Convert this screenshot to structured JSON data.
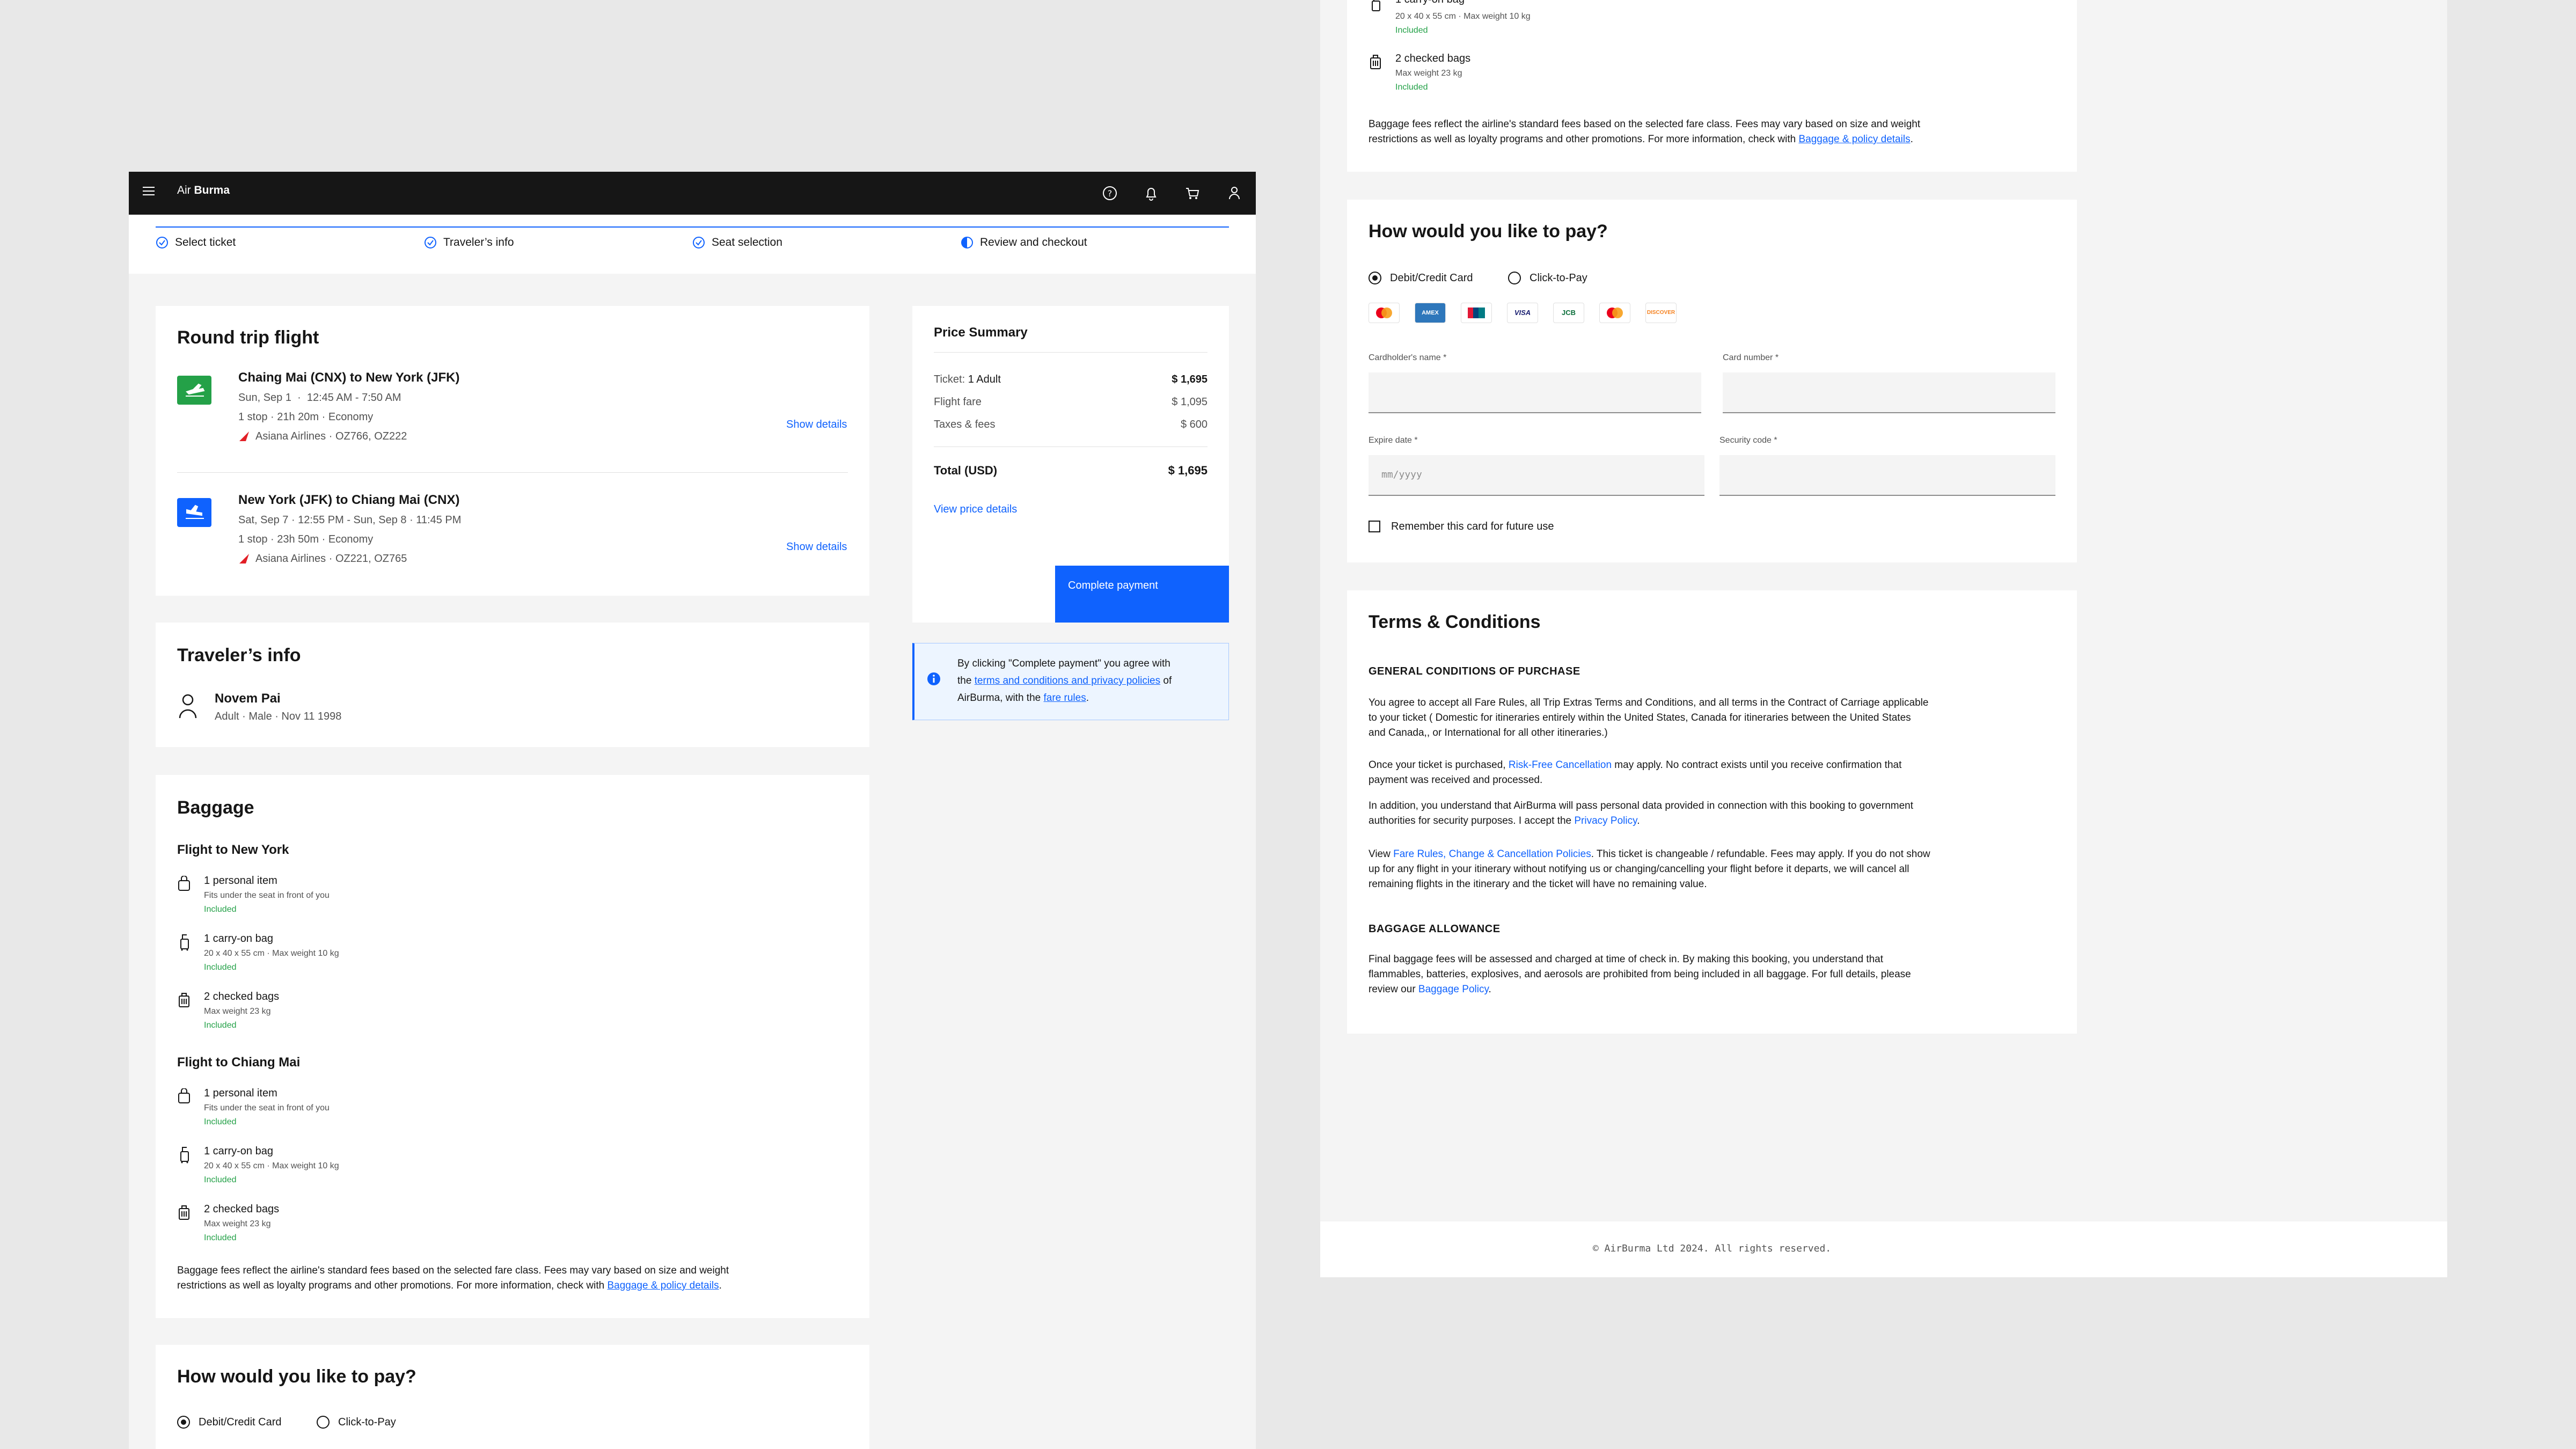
{
  "app": {
    "brand_pre": "Air",
    "brand_main": "Burma"
  },
  "header_icons": [
    "help-icon",
    "notification-icon",
    "cart-icon",
    "user-icon"
  ],
  "steps": [
    {
      "label": "Select ticket",
      "state": "complete"
    },
    {
      "label": "Traveler’s info",
      "state": "complete"
    },
    {
      "label": "Seat selection",
      "state": "complete"
    },
    {
      "label": "Review and checkout",
      "state": "current"
    }
  ],
  "flight": {
    "title": "Round trip flight",
    "legs": [
      {
        "route": "Chaing Mai (CNX) to New York (JFK)",
        "time": "Sun, Sep 1  ·  12:45 AM - 7:50 AM",
        "stops": "1 stop · 21h 20m · Economy",
        "airline": "Asiana Airlines · OZ766, OZ222",
        "details_label": "Show details"
      },
      {
        "route": "New York (JFK) to Chiang Mai (CNX)",
        "time": "Sat, Sep 7 · 12:55 PM - Sun, Sep 8 · 11:45 PM",
        "stops": "1 stop · 23h 50m · Economy",
        "airline": "Asiana Airlines · OZ221, OZ765",
        "details_label": "Show details"
      }
    ]
  },
  "traveler": {
    "title": "Traveler’s info",
    "name": "Novem Pai",
    "meta": "Adult · Male · Nov 11 1998"
  },
  "baggage": {
    "title": "Baggage",
    "groups": [
      {
        "title": "Flight to New York",
        "items": [
          {
            "name": "1 personal item",
            "desc": "Fits under the seat in front of you",
            "status": "Included"
          },
          {
            "name": "1 carry-on bag",
            "desc": "20 x 40 x 55 cm · Max weight 10 kg",
            "status": "Included"
          },
          {
            "name": "2 checked bags",
            "desc": "Max weight 23 kg",
            "status": "Included"
          }
        ]
      },
      {
        "title": "Flight to Chiang Mai",
        "items": [
          {
            "name": "1 personal item",
            "desc": "Fits under the seat in front of you",
            "status": "Included"
          },
          {
            "name": "1 carry-on bag",
            "desc": "20 x 40 x 55 cm · Max weight 10 kg",
            "status": "Included"
          },
          {
            "name": "2 checked bags",
            "desc": "Max weight 23 kg",
            "status": "Included"
          }
        ]
      }
    ],
    "note_line1": "Baggage fees reflect the airline's standard fees based on the selected fare class. Fees may vary based on size and weight",
    "note_line2": "restrictions as well as loyalty programs and other promotions. For more information, check with ",
    "note_link": "Baggage & policy details",
    "note_end": "."
  },
  "price": {
    "title": "Price Summary",
    "ticket_label": "Ticket:",
    "ticket_count": "1 Adult",
    "ticket_value": "$ 1,695",
    "rows": [
      {
        "label": "Flight fare",
        "value": "$ 1,095"
      },
      {
        "label": "Taxes & fees",
        "value": "$ 600"
      }
    ],
    "total_label": "Total (USD)",
    "total_value": "$ 1,695",
    "view_details": "View price details",
    "cta": "Complete payment"
  },
  "notice": {
    "pre": "By clicking \"Complete payment\" you agree with",
    "the": "the ",
    "link1": "terms and conditions and privacy policies",
    "mid": " of",
    "line3": "AirBurma, with the ",
    "link2": "fare rules",
    "end": "."
  },
  "payment": {
    "title": "How would you like to pay?",
    "options": [
      {
        "label": "Debit/Credit Card",
        "selected": true
      },
      {
        "label": "Click-to-Pay",
        "selected": false
      }
    ],
    "card_brands": [
      "mastercard",
      "AMEX",
      "UnionPay",
      "VISA",
      "JCB",
      "maestro",
      "DISCOVER"
    ],
    "fields": {
      "name_label": "Cardholder's name *",
      "number_label": "Card number *",
      "expiry_label": "Expire date *",
      "expiry_placeholder": "mm/yyyy",
      "code_label": "Security code *"
    },
    "remember": "Remember this card for future use"
  },
  "terms": {
    "title": "Terms & Conditions",
    "general_heading": "GENERAL CONDITIONS OF PURCHASE",
    "p1": [
      "You agree to accept all Fare Rules, all Trip Extras Terms and Conditions, and all terms in the Contract of Carriage applicable",
      "to your ticket ( Domestic for itineraries entirely within the United States, Canada for itineraries between the United States",
      "and Canada,, or International for all other itineraries.)"
    ],
    "p2_pre": "Once your ticket is purchased, ",
    "p2_link": "Risk-Free Cancellation",
    "p2_post": " may apply. No contract exists until you receive confirmation that",
    "p2_line2": "payment was received and processed.",
    "p3_line1": "In addition, you understand that AirBurma will pass personal data provided in connection with this booking to government",
    "p3_pre": "authorities for security purposes. I accept the ",
    "p3_link": "Privacy Policy",
    "p3_end": ".",
    "p4_pre": "View ",
    "p4_link": "Fare Rules, Change & Cancellation Policies",
    "p4_post": ". This ticket is changeable / refundable. Fees may apply. If you do not show",
    "p4_line2": "up for any flight in your itinerary without notifying us or changing/cancelling your flight before it departs, we will cancel all",
    "p4_line3": "remaining flights in the itinerary and the ticket will have no remaining value.",
    "allowance_heading": "BAGGAGE ALLOWANCE",
    "p5_line1": "Final baggage fees will be assessed and charged at time of check in. By making this booking, you understand that",
    "p5_line2": "flammables, batteries, explosives, and aerosols are prohibited from being included in all baggage. For full details, please",
    "p5_pre": "review our ",
    "p5_link": "Baggage Policy",
    "p5_end": "."
  },
  "footer": {
    "text": "© AirBurma Ltd 2024. All rights reserved."
  }
}
